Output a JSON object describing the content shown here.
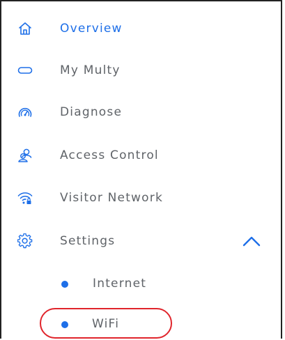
{
  "menu": {
    "items": [
      {
        "label": "Overview",
        "icon": "home-icon",
        "active": true
      },
      {
        "label": "My Multy",
        "icon": "multy-device-icon",
        "active": false
      },
      {
        "label": "Diagnose",
        "icon": "speedometer-icon",
        "active": false
      },
      {
        "label": "Access Control",
        "icon": "users-icon",
        "active": false
      },
      {
        "label": "Visitor Network",
        "icon": "wifi-lock-icon",
        "active": false
      },
      {
        "label": "Settings",
        "icon": "gear-icon",
        "active": false,
        "expanded": true,
        "toggle_icon": "chevron-up-icon"
      }
    ],
    "settings_submenu": [
      {
        "label": "Internet"
      },
      {
        "label": "WiFi",
        "highlighted": true
      }
    ]
  },
  "colors": {
    "accent": "#1e6fe8",
    "text": "#5f6368",
    "highlight": "#e0242b"
  }
}
